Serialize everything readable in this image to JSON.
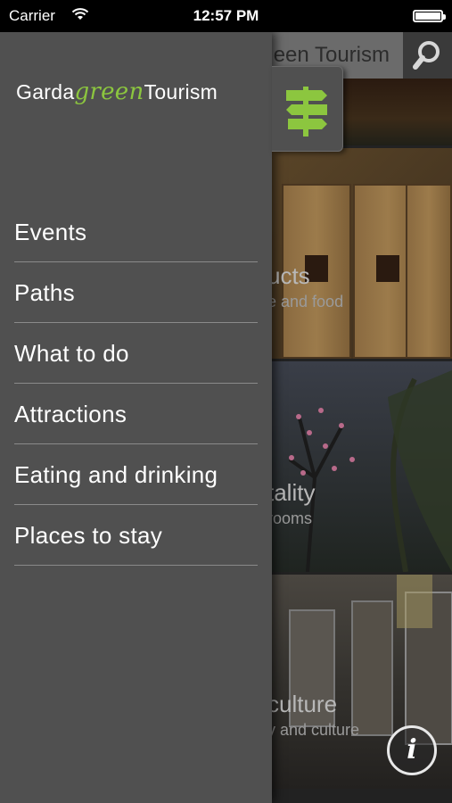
{
  "status_bar": {
    "carrier": "Carrier",
    "time": "12:57 PM"
  },
  "header": {
    "title_partial": "een Tourism"
  },
  "logo": {
    "part1": "Garda",
    "part2": "green",
    "part3": "Tourism"
  },
  "menu": {
    "items": [
      {
        "label": "Events"
      },
      {
        "label": "Paths"
      },
      {
        "label": "What to do"
      },
      {
        "label": "Attractions"
      },
      {
        "label": "Eating and drinking"
      },
      {
        "label": "Places to stay"
      }
    ]
  },
  "tiles": [
    {
      "title": "ucts",
      "subtitle": "e and food"
    },
    {
      "title": "tality",
      "subtitle": "rooms"
    },
    {
      "title": "culture",
      "subtitle": "y and culture"
    }
  ],
  "icons": {
    "search": "search-icon",
    "signpost": "signpost-icon",
    "info": "info-icon",
    "wifi": "wifi-icon",
    "battery": "battery-icon"
  },
  "colors": {
    "brand_green": "#8cc63f",
    "drawer_bg": "#505050"
  },
  "info_button": {
    "glyph": "i"
  }
}
